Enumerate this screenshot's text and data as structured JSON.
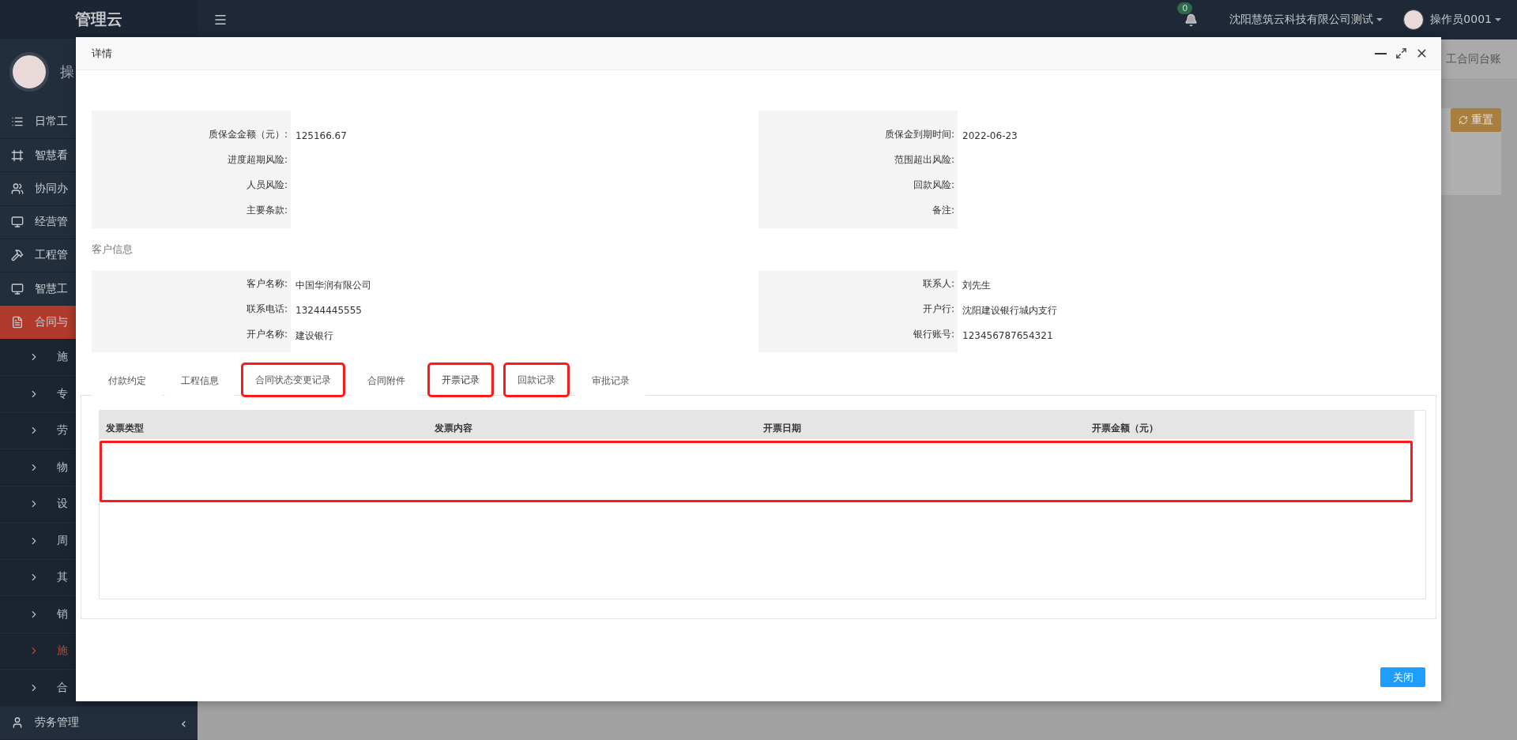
{
  "app": {
    "logo": "管理云",
    "profile_name": "操"
  },
  "sidebar": {
    "items": [
      {
        "label": "日常工",
        "selected": false
      },
      {
        "label": "智慧看",
        "selected": false
      },
      {
        "label": "协同办",
        "selected": false
      },
      {
        "label": "经营管",
        "selected": false
      },
      {
        "label": "工程管",
        "selected": false
      },
      {
        "label": "智慧工",
        "selected": false
      },
      {
        "label": "合同与",
        "selected": true,
        "children": [
          {
            "label": "施",
            "selected": false
          },
          {
            "label": "专",
            "selected": false
          },
          {
            "label": "劳",
            "selected": false
          },
          {
            "label": "物",
            "selected": false
          },
          {
            "label": "设",
            "selected": false
          },
          {
            "label": "周",
            "selected": false
          },
          {
            "label": "其",
            "selected": false
          },
          {
            "label": "销",
            "selected": false
          },
          {
            "label": "施",
            "selected": true
          },
          {
            "label": "合",
            "selected": false
          }
        ]
      },
      {
        "label": "劳务管理",
        "selected": false,
        "arrow": "‹"
      }
    ]
  },
  "topbar": {
    "notification_count": "0",
    "company": "沈阳慧筑云科技有限公司测试",
    "user": "操作员0001"
  },
  "background_page": {
    "breadcrumb": "工合同台账",
    "reset_button": "重置"
  },
  "dialog": {
    "title": "详情",
    "contract_rows": [
      {
        "left_label": "质保金金额（元）:",
        "left_value": "125166.67",
        "right_label": "质保金到期时间:",
        "right_value": "2022-06-23"
      },
      {
        "left_label": "进度超期风险:",
        "right_label": "范围超出风险:"
      },
      {
        "left_label": "人员风险:",
        "right_label": "回款风险:"
      },
      {
        "left_label": "主要条款:",
        "right_label": "备注:"
      }
    ],
    "customer_section_title": "客户信息",
    "customer_rows": [
      {
        "left_label": "客户名称:",
        "left_value": "中国华润有限公司",
        "right_label": "联系人:",
        "right_value": "刘先生"
      },
      {
        "left_label": "联系电话:",
        "left_value": "13244445555",
        "right_label": "开户行:",
        "right_value": "沈阳建设银行城内支行"
      },
      {
        "left_label": "开户名称:",
        "left_value": "建设银行",
        "right_label": "银行账号:",
        "right_value": "123456787654321"
      }
    ],
    "tabs": [
      {
        "label": "付款约定",
        "selected": false,
        "marked": false
      },
      {
        "label": "工程信息",
        "selected": false,
        "marked": false
      },
      {
        "label": "合同状态变更记录",
        "selected": false,
        "marked": true
      },
      {
        "label": "合同附件",
        "selected": false,
        "marked": false
      },
      {
        "label": "开票记录",
        "selected": true,
        "marked": true
      },
      {
        "label": "回款记录",
        "selected": false,
        "marked": true
      },
      {
        "label": "审批记录",
        "selected": false,
        "marked": false
      }
    ],
    "table": {
      "columns": [
        "发票类型",
        "发票内容",
        "开票日期",
        "开票金额（元）"
      ],
      "empty_row_marked": true
    },
    "close_button": "关闭"
  }
}
